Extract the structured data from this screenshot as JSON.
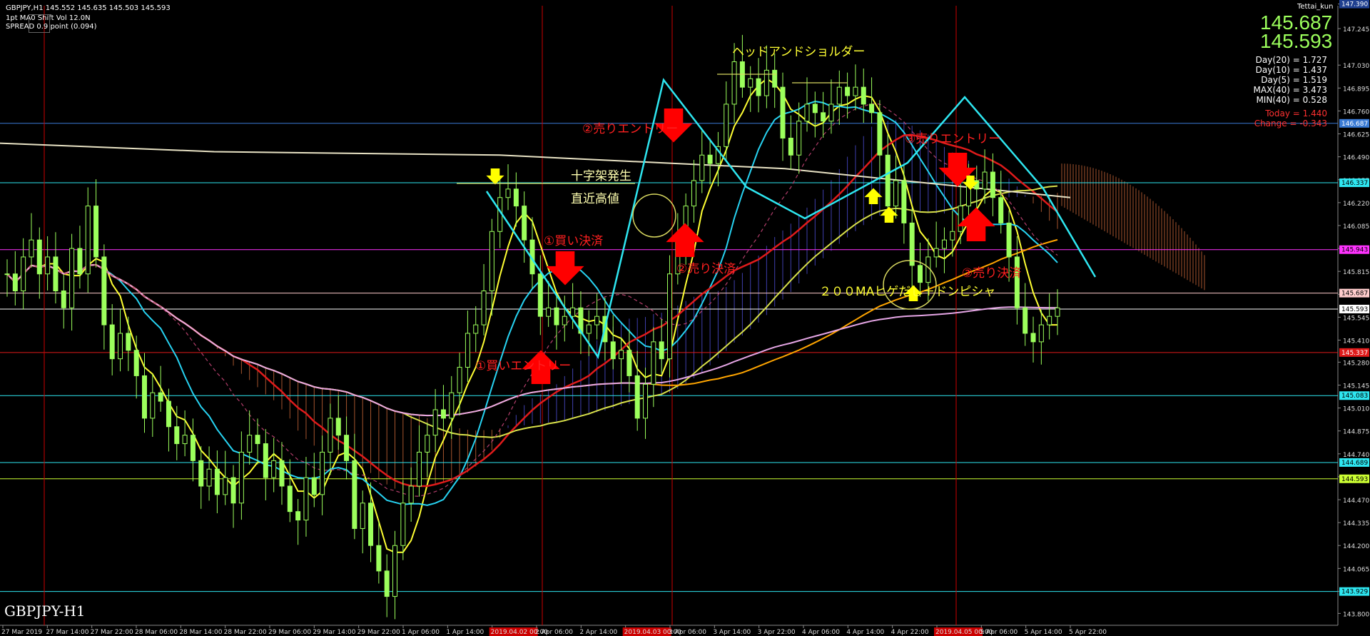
{
  "header": {
    "symbol_line": "GBPJPY,H1  145.552 145.635 145.503 145.593",
    "line2": "1pt  MA0 Shift Vol 12.0N",
    "line3": "SPREAD 0.9 point (0.094)",
    "user": "Tettai_kun"
  },
  "panel": {
    "bid": "145.687",
    "ask": "145.593",
    "stats": [
      "Day(20) = 1.727",
      "Day(10) = 1.437",
      "Day(5) = 1.519",
      "MAX(40) = 3.473",
      "MIN(40) = 0.528"
    ],
    "today": "Today = 1.440",
    "change": "Change = -0.343"
  },
  "chart_title": "GBPJPY-H1",
  "annotations": {
    "head_shoulders": "ヘッドアンドショルダー",
    "cross_pattern": "十字架発生",
    "recent_high": "直近高値",
    "buy_close_1": "①買い決済",
    "buy_entry_1": "①買いエントリー",
    "sell_entry_2": "②売りエントリー",
    "sell_close_2": "②売り決済",
    "sell_entry_3": "③売りエントリー",
    "sell_close_3": "③売り決済",
    "ma200": "２００MAヒゲだし＋ドンピシャ"
  },
  "colors": {
    "candle": "#9cff5c",
    "ma_cyan": "#27d3f2",
    "ma_red": "#e01b1b",
    "ma_yellow": "#ffff33",
    "ma_orange": "#ffa500",
    "ma_pink": "#e6a6e6",
    "ma_white": "#e8e2c4",
    "arrow_red": "#ff0000",
    "arrow_yellow": "#ffff00",
    "zigzag": "#2ee6f0",
    "text_red": "#ff2020",
    "text_yellow": "#ffff33"
  },
  "chart_data": {
    "type": "candlestick",
    "ylim": [
      143.73,
      147.38
    ],
    "y_ticks": [
      "147.390",
      "147.245",
      "147.030",
      "146.895",
      "146.760",
      "146.625",
      "146.490",
      "146.355",
      "146.220",
      "146.085",
      "145.950",
      "145.815",
      "145.680",
      "145.545",
      "145.410",
      "145.280",
      "145.145",
      "145.010",
      "144.875",
      "144.740",
      "144.605",
      "144.470",
      "144.335",
      "144.200",
      "144.065",
      "143.930",
      "143.800"
    ],
    "price_labels": [
      {
        "label": "147.390",
        "price": 147.39,
        "color": "#1f3f8f"
      },
      {
        "label": "146.687",
        "price": 146.687,
        "color": "#3a7bd5"
      },
      {
        "label": "146.337",
        "price": 146.337,
        "color": "#2ee6f0"
      },
      {
        "label": "145.943",
        "price": 145.943,
        "color": "#ff33ff"
      },
      {
        "label": "145.687",
        "price": 145.687,
        "color": "#ffcccc"
      },
      {
        "label": "145.593",
        "price": 145.593,
        "color": "#ffffff"
      },
      {
        "label": "145.337",
        "price": 145.337,
        "color": "#e01b1b"
      },
      {
        "label": "145.083",
        "price": 145.083,
        "color": "#2ee6f0"
      },
      {
        "label": "144.689",
        "price": 144.689,
        "color": "#2ee6f0"
      },
      {
        "label": "144.593",
        "price": 144.593,
        "color": "#ccff33"
      },
      {
        "label": "143.929",
        "price": 143.929,
        "color": "#2ee6f0"
      }
    ],
    "x_labels": [
      "27 Mar 2019",
      "27 Mar 14:00",
      "27 Mar 22:00",
      "28 Mar 06:00",
      "28 Mar 14:00",
      "28 Mar 22:00",
      "29 Mar 06:00",
      "29 Mar 14:00",
      "29 Mar 22:00",
      "1 Apr 06:00",
      "1 Apr 14:00",
      "2019.04.02 00:00",
      "2 Apr 06:00",
      "2 Apr 14:00",
      "2019.04.03 00:00",
      "3 Apr 06:00",
      "3 Apr 14:00",
      "3 Apr 22:00",
      "4 Apr 06:00",
      "4 Apr 14:00",
      "4 Apr 22:00",
      "2019.04.05 00:00",
      "5 Apr 06:00",
      "5 Apr 14:00",
      "5 Apr 22:00"
    ],
    "closes": [
      145.8,
      145.7,
      145.9,
      146.0,
      145.8,
      145.9,
      145.7,
      145.6,
      145.95,
      145.8,
      146.2,
      145.9,
      145.5,
      145.3,
      145.45,
      145.35,
      145.2,
      144.95,
      145.1,
      145.05,
      144.9,
      144.8,
      144.85,
      144.7,
      144.55,
      144.65,
      144.5,
      144.6,
      144.45,
      144.75,
      144.85,
      144.8,
      144.6,
      144.7,
      144.55,
      144.4,
      144.35,
      144.6,
      144.5,
      144.75,
      144.95,
      144.85,
      144.7,
      144.3,
      144.45,
      144.2,
      144.05,
      143.9,
      144.2,
      144.45,
      144.55,
      144.75,
      144.85,
      145.0,
      144.95,
      145.1,
      145.25,
      145.45,
      145.5,
      145.7,
      146.05,
      146.25,
      146.3,
      146.2,
      146.0,
      145.8,
      145.55,
      145.6,
      145.5,
      145.55,
      145.6,
      145.45,
      145.5,
      145.55,
      145.4,
      145.3,
      145.35,
      145.2,
      144.95,
      145.15,
      145.4,
      145.3,
      145.8,
      146.0,
      146.2,
      146.35,
      146.5,
      146.45,
      146.55,
      146.8,
      147.05,
      146.9,
      146.95,
      146.85,
      147.0,
      146.9,
      146.6,
      146.5,
      146.7,
      146.8,
      146.75,
      146.7,
      146.8,
      146.9,
      146.85,
      146.9,
      146.8,
      146.75,
      146.5,
      146.2,
      146.35,
      146.1,
      145.85,
      145.75,
      145.9,
      145.95,
      146.0,
      146.05,
      146.2,
      146.35,
      146.3,
      146.4,
      146.25,
      146.1,
      145.9,
      145.6,
      145.45,
      145.4,
      145.5,
      145.55,
      145.6
    ]
  }
}
